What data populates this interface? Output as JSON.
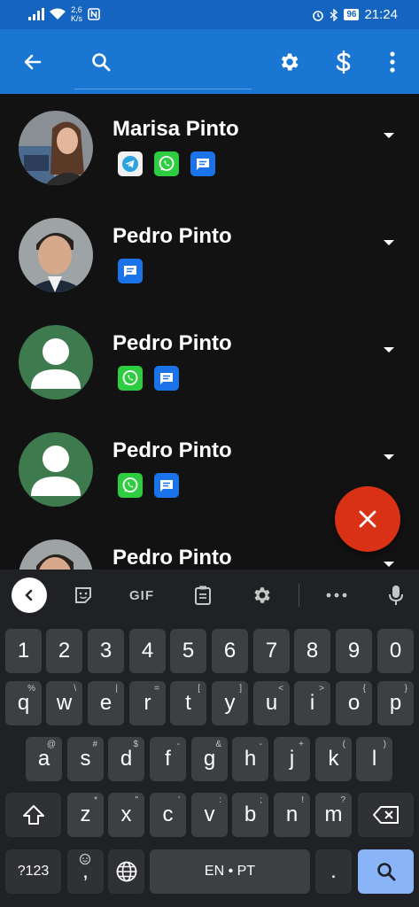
{
  "status_bar": {
    "network_speed_value": "2,6",
    "network_speed_unit": "K/s",
    "battery": "96",
    "time": "21:24"
  },
  "app_bar": {
    "search_placeholder": "",
    "icons": [
      "back-arrow-icon",
      "search-icon",
      "settings-gear-icon",
      "dollar-icon",
      "more-vert-icon"
    ]
  },
  "contacts": [
    {
      "name": "Marisa Pinto",
      "avatar": "photo-woman",
      "apps": [
        "telegram",
        "whatsapp",
        "messages"
      ]
    },
    {
      "name": "Pedro Pinto",
      "avatar": "photo-man",
      "apps": [
        "messages"
      ]
    },
    {
      "name": "Pedro Pinto",
      "avatar": "default-person",
      "apps": [
        "whatsapp",
        "messages"
      ]
    },
    {
      "name": "Pedro Pinto",
      "avatar": "default-person",
      "apps": [
        "whatsapp",
        "messages"
      ]
    },
    {
      "name": "Pedro Pinto",
      "avatar": "photo-man",
      "apps": []
    }
  ],
  "fab": {
    "icon": "close-icon",
    "color": "#d93116"
  },
  "colors": {
    "status_bar": "#1565c0",
    "app_bar": "#1976d2",
    "background": "#121212",
    "whatsapp": "#2ecc40",
    "messages": "#1a73e8"
  },
  "keyboard": {
    "toolbar": {
      "gif_label": "GIF",
      "icons": [
        "chevron-left-icon",
        "sticker-icon",
        "clipboard-icon",
        "settings-gear-icon",
        "more-horiz-icon",
        "mic-icon"
      ]
    },
    "row_numbers": [
      "1",
      "2",
      "3",
      "4",
      "5",
      "6",
      "7",
      "8",
      "9",
      "0"
    ],
    "row1": [
      {
        "key": "q",
        "hint": "%"
      },
      {
        "key": "w",
        "hint": "\\"
      },
      {
        "key": "e",
        "hint": "|"
      },
      {
        "key": "r",
        "hint": "="
      },
      {
        "key": "t",
        "hint": "["
      },
      {
        "key": "y",
        "hint": "]"
      },
      {
        "key": "u",
        "hint": "<"
      },
      {
        "key": "i",
        "hint": ">"
      },
      {
        "key": "o",
        "hint": "{"
      },
      {
        "key": "p",
        "hint": "}"
      }
    ],
    "row2": [
      {
        "key": "a",
        "hint": "@"
      },
      {
        "key": "s",
        "hint": "#"
      },
      {
        "key": "d",
        "hint": "$"
      },
      {
        "key": "f",
        "hint": "-"
      },
      {
        "key": "g",
        "hint": "&"
      },
      {
        "key": "h",
        "hint": "-"
      },
      {
        "key": "j",
        "hint": "+"
      },
      {
        "key": "k",
        "hint": "("
      },
      {
        "key": "l",
        "hint": ")"
      }
    ],
    "row3": [
      {
        "key": "z",
        "hint": "*"
      },
      {
        "key": "x",
        "hint": "\""
      },
      {
        "key": "c",
        "hint": "'"
      },
      {
        "key": "v",
        "hint": ":"
      },
      {
        "key": "b",
        "hint": ";"
      },
      {
        "key": "n",
        "hint": "!"
      },
      {
        "key": "m",
        "hint": "?"
      }
    ],
    "symbols_label": "?123",
    "comma_label": ",",
    "space_label": "EN • PT",
    "period_label": "."
  }
}
